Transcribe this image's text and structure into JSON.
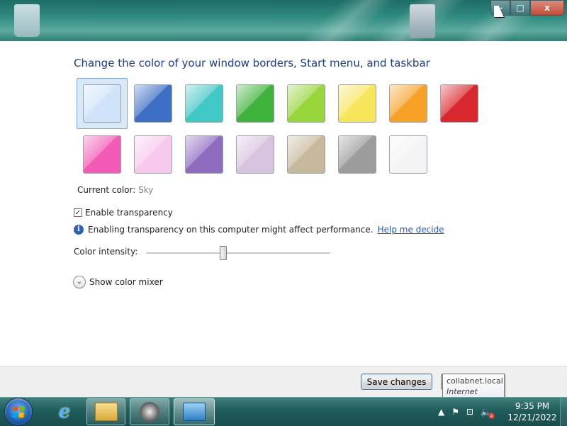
{
  "window": {
    "controls": {
      "minimize": "–",
      "maximize": "□",
      "close": "x"
    }
  },
  "main": {
    "heading": "Change the color of your window borders, Start menu, and taskbar",
    "current_color_label": "Current color:",
    "current_color_value": "Sky",
    "transparency": {
      "label": "Enable transparency",
      "checked": true,
      "check_glyph": "✓"
    },
    "info": {
      "icon_text": "i",
      "text": "Enabling transparency on this computer might affect performance.",
      "link": "Help me decide"
    },
    "intensity": {
      "label": "Color intensity:",
      "value_fraction": 0.42
    },
    "mixer": {
      "label": "Show color mixer",
      "chevron": "⌄"
    }
  },
  "swatches": [
    {
      "name": "sky",
      "color": "#cfe4fb",
      "selected": true
    },
    {
      "name": "twilight",
      "color": "#3e6fc6",
      "selected": false
    },
    {
      "name": "sea",
      "color": "#40c8c6",
      "selected": false
    },
    {
      "name": "leaf",
      "color": "#3fb33b",
      "selected": false
    },
    {
      "name": "lime",
      "color": "#96d63a",
      "selected": false
    },
    {
      "name": "lemon",
      "color": "#f7e55a",
      "selected": false
    },
    {
      "name": "pumpkin",
      "color": "#f7a227",
      "selected": false
    },
    {
      "name": "ruby",
      "color": "#d9272e",
      "selected": false
    },
    {
      "name": "fuchsia",
      "color": "#f25ab5",
      "selected": false
    },
    {
      "name": "blush",
      "color": "#f7c9ec",
      "selected": false
    },
    {
      "name": "violet",
      "color": "#8f6cc0",
      "selected": false
    },
    {
      "name": "lavender",
      "color": "#d9c4e0",
      "selected": false
    },
    {
      "name": "taupe",
      "color": "#c7b99c",
      "selected": false
    },
    {
      "name": "chocolate-gray",
      "color": "#9c9c9c",
      "selected": false
    },
    {
      "name": "frost",
      "color": "#f4f4f4",
      "selected": false
    }
  ],
  "footer": {
    "save_label": "Save changes"
  },
  "tooltip": {
    "title": "collabnet.local",
    "subtitle": "Internet access"
  },
  "taskbar": {
    "ie_glyph": "e",
    "tray": {
      "arrow": "▲",
      "flag": "⚑",
      "network": "⊡",
      "volume": "🔈",
      "mute_x": "x"
    },
    "clock": {
      "time": "9:35 PM",
      "date": "12/21/2022"
    }
  }
}
